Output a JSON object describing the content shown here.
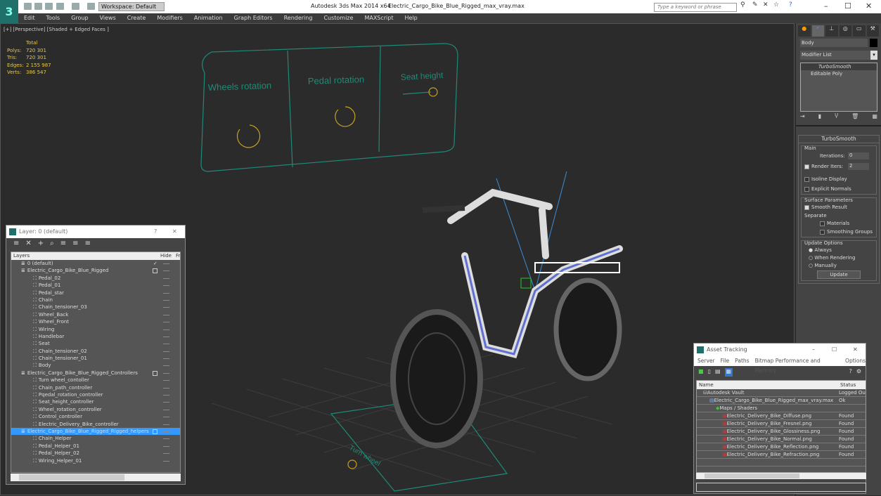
{
  "titlebar": {
    "app": "Autodesk 3ds Max  2014 x64",
    "file": "Electric_Cargo_Bike_Blue_Rigged_max_vray.max",
    "workspace": "Workspace: Default",
    "search_placeholder": "Type a keyword or phrase"
  },
  "menu": [
    "Edit",
    "Tools",
    "Group",
    "Views",
    "Create",
    "Modifiers",
    "Animation",
    "Graph Editors",
    "Rendering",
    "Customize",
    "MAXScript",
    "Help"
  ],
  "viewport": {
    "label": "[+] [Perspective] [Shaded + Edged Faces ]",
    "stats": {
      "header": "Total",
      "rows": [
        {
          "k": "Polys:",
          "v": "720 301"
        },
        {
          "k": "Tris:",
          "v": "720 301"
        },
        {
          "k": "Edges:",
          "v": "2 155 987"
        },
        {
          "k": "Verts:",
          "v": "386 547"
        }
      ]
    },
    "controls": {
      "wheels": "Wheels rotation",
      "pedal": "Pedal rotation",
      "seat": "Seat height",
      "turn": "Turn wheel"
    }
  },
  "command_panel": {
    "object_name": "Body",
    "modifier_list": "Modifier List",
    "stack": [
      "TurboSmooth",
      "Editable Poly"
    ],
    "rollout": {
      "title": "TurboSmooth",
      "main": "Main",
      "iterations_label": "Iterations:",
      "iterations": "0",
      "render_iters_label": "Render Iters:",
      "render_iters": "2",
      "render_iters_checked": true,
      "isoline": "Isoline Display",
      "explicit": "Explicit Normals",
      "surface": "Surface Parameters",
      "smooth_result": "Smooth Result",
      "separate": "Separate",
      "materials": "Materials",
      "smoothing_groups": "Smoothing Groups",
      "update_options": "Update Options",
      "always": "Always",
      "when_rendering": "When Rendering",
      "manually": "Manually",
      "update": "Update"
    }
  },
  "layer_dialog": {
    "title": "Layer: 0 (default)",
    "help": "?",
    "col_layers": "Layers",
    "col_hide": "Hide",
    "col_fr": "Fr",
    "rows": [
      {
        "name": "0 (default)",
        "level": 0,
        "active": true
      },
      {
        "name": "Electric_Cargo_Bike_Blue_Rigged",
        "level": 0
      },
      {
        "name": "Pedal_02",
        "level": 1
      },
      {
        "name": "Pedal_01",
        "level": 1
      },
      {
        "name": "Pedal_star",
        "level": 1
      },
      {
        "name": "Chain",
        "level": 1
      },
      {
        "name": "Chain_tensioner_03",
        "level": 1
      },
      {
        "name": "Wheel_Back",
        "level": 1
      },
      {
        "name": "Wheel_Front",
        "level": 1
      },
      {
        "name": "Wiring",
        "level": 1
      },
      {
        "name": "Handlebar",
        "level": 1
      },
      {
        "name": "Seat",
        "level": 1
      },
      {
        "name": "Chain_tensioner_02",
        "level": 1
      },
      {
        "name": "Chain_tensioner_01",
        "level": 1
      },
      {
        "name": "Body",
        "level": 1
      },
      {
        "name": "Electric_Cargo_Bike_Blue_Rigged_Controllers",
        "level": 0
      },
      {
        "name": "Turn wheel_contoller",
        "level": 1
      },
      {
        "name": "Chain_path_controller",
        "level": 1
      },
      {
        "name": "Pqedal_rotation_controller",
        "level": 1
      },
      {
        "name": "Seat_height_controller",
        "level": 1
      },
      {
        "name": "Wheel_rotation_controller",
        "level": 1
      },
      {
        "name": "Control_controller",
        "level": 1
      },
      {
        "name": "Electric_Delivery_Bike_controller",
        "level": 1
      },
      {
        "name": "Electric_Cargo_Bike_Blue_Rigged_Rigged_helpers",
        "level": 0,
        "selected": true
      },
      {
        "name": "Chain_Helper",
        "level": 1
      },
      {
        "name": "Pedal_Helper_01",
        "level": 1
      },
      {
        "name": "Pedal_Helper_02",
        "level": 1
      },
      {
        "name": "Wiring_Helper_01",
        "level": 1
      }
    ]
  },
  "asset_tracking": {
    "title": "Asset Tracking",
    "menu": [
      "Server",
      "File",
      "Paths",
      "Bitmap Performance and Memory",
      "Options"
    ],
    "col_name": "Name",
    "col_status": "Status",
    "rows": [
      {
        "name": "Autodesk Vault",
        "status": "Logged Ou",
        "level": 1
      },
      {
        "name": "Electric_Cargo_Bike_Blue_Rigged_max_vray.max",
        "status": "Ok",
        "level": 2
      },
      {
        "name": "Maps / Shaders",
        "status": "",
        "level": 3
      },
      {
        "name": "Electric_Delivery_Bike_Diffuse.png",
        "status": "Found",
        "level": 4
      },
      {
        "name": "Electric_Delivery_Bike_Fresnel.png",
        "status": "Found",
        "level": 4
      },
      {
        "name": "Electric_Delivery_Bike_Glossiness.png",
        "status": "Found",
        "level": 4
      },
      {
        "name": "Electric_Delivery_Bike_Normal.png",
        "status": "Found",
        "level": 4
      },
      {
        "name": "Electric_Delivery_Bike_Reflection.png",
        "status": "Found",
        "level": 4
      },
      {
        "name": "Electric_Delivery_Bike_Refraction.png",
        "status": "Found",
        "level": 4
      }
    ]
  },
  "colors": {
    "accent": "#3399ff",
    "stats": "#e8c84a",
    "controller": "#1f8a78",
    "wireframe": "#ffffff"
  }
}
